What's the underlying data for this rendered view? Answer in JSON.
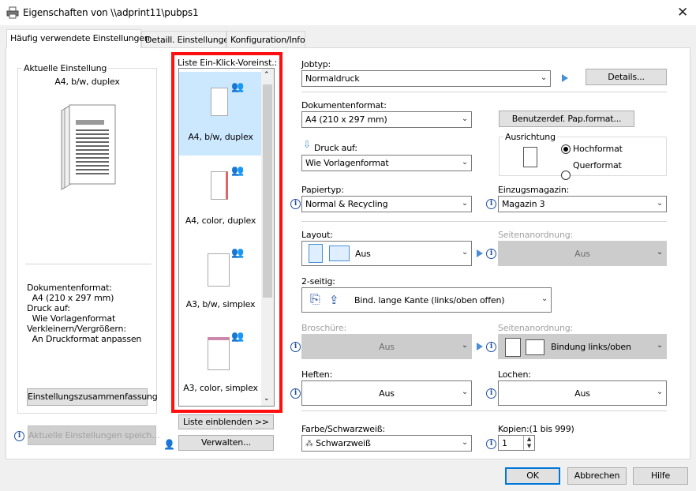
{
  "window": {
    "title": "Eigenschaften von \\\\adprint11\\pubps1"
  },
  "tabs": [
    {
      "label": "Häufig verwendete Einstellungen"
    },
    {
      "label": "Detaill. Einstellungen"
    },
    {
      "label": "Konfiguration/Info"
    }
  ],
  "current": {
    "group_title": "Aktuelle Einstellung",
    "summary": "A4, b/w, duplex",
    "details": [
      "Dokumentenformat:",
      "  A4 (210 x 297 mm)",
      "Druck auf:",
      "  Wie Vorlagenformat",
      "Verkleinern/Vergrößern:",
      "  An Druckformat anpassen"
    ],
    "summary_button": "Einstellungszusammenfassung",
    "save_button": "Aktuelle Einstellungen speich..."
  },
  "oneclick": {
    "title": "Liste Ein-Klick-Voreinst.:",
    "items": [
      {
        "label": "A4, b/w, duplex"
      },
      {
        "label": "A4, color, duplex"
      },
      {
        "label": "A3, b/w, simplex"
      },
      {
        "label": "A3, color, simplex"
      }
    ],
    "show_list_button": "Liste einblenden >>",
    "manage_button": "Verwalten..."
  },
  "settings": {
    "jobtype_label": "Jobtyp:",
    "jobtype_value": "Normaldruck",
    "details_button": "Details...",
    "docformat_label": "Dokumentenformat:",
    "docformat_value": "A4 (210 x 297 mm)",
    "custom_format_button": "Benutzerdef. Pap.format...",
    "printon_label": "Druck auf:",
    "printon_value": "Wie Vorlagenformat",
    "orientation_title": "Ausrichtung",
    "portrait": "Hochformat",
    "landscape": "Querformat",
    "papertype_label": "Papiertyp:",
    "papertype_value": "Normal & Recycling",
    "tray_label": "Einzugsmagazin:",
    "tray_value": "Magazin 3",
    "layout_label": "Layout:",
    "layout_value": "Aus",
    "pageorder_label": "Seitenanordnung:",
    "pageorder_value": "Aus",
    "duplex_label": "2-seitig:",
    "duplex_value": "Bind. lange Kante (links/oben offen)",
    "booklet_label": "Broschüre:",
    "booklet_value": "Aus",
    "pageorder2_label": "Seitenanordnung:",
    "pageorder2_value": "Bindung links/oben",
    "staple_label": "Heften:",
    "staple_value": "Aus",
    "punch_label": "Lochen:",
    "punch_value": "Aus",
    "color_label": "Farbe/Schwarzweiß:",
    "color_value": "Schwarzweiß",
    "copies_label": "Kopien:(1 bis 999)",
    "copies_value": "1"
  },
  "footer": {
    "ok": "OK",
    "cancel": "Abbrechen",
    "help": "Hilfe"
  },
  "colors": {
    "selection": "#cce8ff",
    "highlight_frame": "#ff1010",
    "accent": "#0078d7"
  }
}
